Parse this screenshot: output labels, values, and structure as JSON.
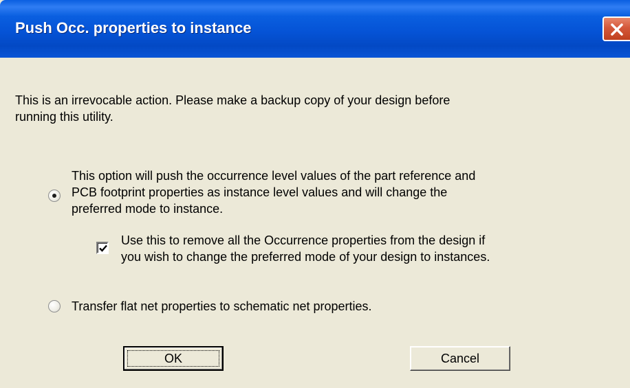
{
  "window": {
    "title": "Push Occ. properties to instance"
  },
  "message": {
    "line1": "This is an irrevocable action. Please make a backup copy of your design before",
    "line2": "running this utility."
  },
  "option_push": {
    "selected": true,
    "line1": "This option will push the occurrence level values of the part reference and",
    "line2": "PCB footprint properties as instance level values and will change the",
    "line3": "preferred mode to instance."
  },
  "remove_occurrence": {
    "checked": true,
    "line1": "Use this to remove all the Occurrence properties from the  design if",
    "line2": "you wish to change the preferred mode of your design to instances."
  },
  "option_transfer": {
    "selected": false,
    "label": "Transfer flat net properties to schematic net properties."
  },
  "buttons": {
    "ok": "OK",
    "cancel": "Cancel"
  },
  "icons": {
    "close": "close-icon",
    "checkmark": "checkmark-icon"
  },
  "colors": {
    "titlebar": "#0553d6",
    "dialog_bg": "#ece9d8",
    "close_button": "#d4583a"
  }
}
